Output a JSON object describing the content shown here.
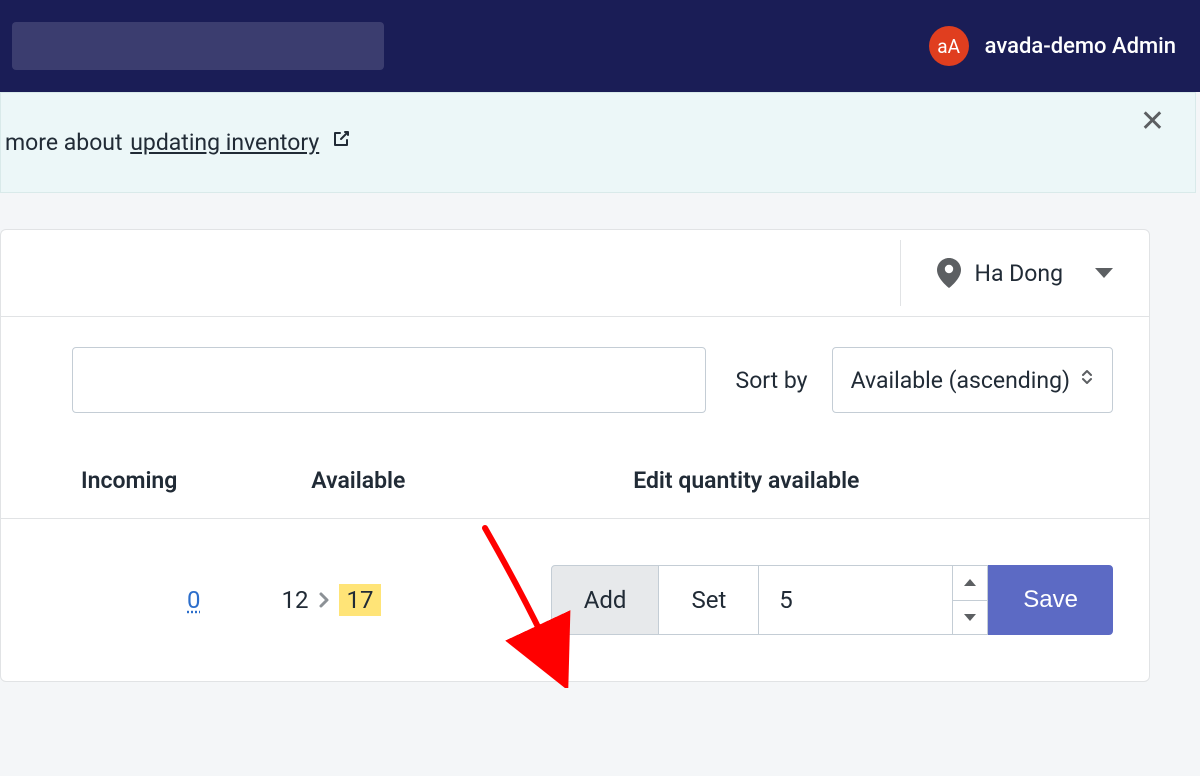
{
  "header": {
    "avatar_text": "aA",
    "username": "avada-demo Admin"
  },
  "banner": {
    "prefix_text": "more about ",
    "link_text": "updating inventory"
  },
  "location": {
    "label": "Ha Dong"
  },
  "filters": {
    "sort_label": "Sort by",
    "sort_value": "Available (ascending)"
  },
  "table": {
    "columns": {
      "incoming": "Incoming",
      "available": "Available",
      "edit": "Edit quantity available"
    },
    "row": {
      "incoming": "0",
      "available_old": "12",
      "available_new": "17",
      "edit": {
        "add_label": "Add",
        "set_label": "Set",
        "quantity": "5",
        "save_label": "Save"
      }
    }
  }
}
